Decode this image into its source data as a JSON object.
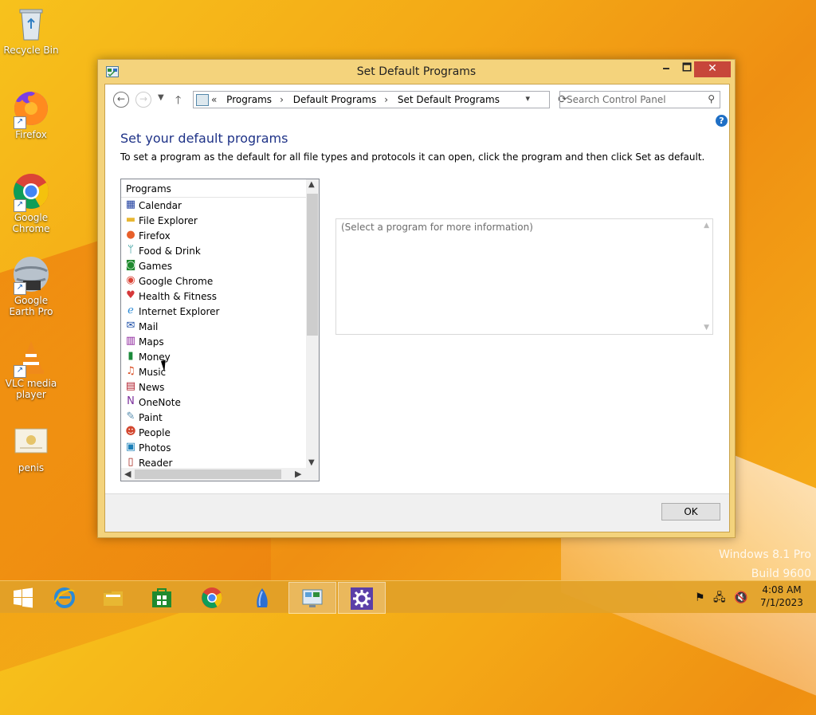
{
  "desktop": {
    "icons": [
      {
        "label": "Recycle Bin"
      },
      {
        "label": "Firefox"
      },
      {
        "label": "Google Chrome"
      },
      {
        "label": "Google Earth Pro"
      },
      {
        "label": "VLC media player"
      },
      {
        "label": "penis"
      }
    ],
    "watermark": {
      "line1": "Windows 8.1 Pro",
      "line2": "Build 9600"
    }
  },
  "window": {
    "title": "Set Default Programs",
    "controls": {
      "minimize": "🗕",
      "maximize": "🗖",
      "close": "✕"
    },
    "breadcrumb": {
      "prefix": "«",
      "items": [
        "Programs",
        "Default Programs",
        "Set Default Programs"
      ],
      "separator": "›"
    },
    "search_placeholder": "Search Control Panel",
    "heading": "Set your default programs",
    "description": "To set a program as the default for all file types and protocols it can open, click the program and then click Set as default.",
    "list": {
      "header": "Programs",
      "items": [
        {
          "label": "Calendar",
          "icon": "calendar-icon",
          "color": "#1f3fa0"
        },
        {
          "label": "File Explorer",
          "icon": "folder-icon",
          "color": "#e8b732"
        },
        {
          "label": "Firefox",
          "icon": "firefox-icon",
          "color": "#e8602b"
        },
        {
          "label": "Food & Drink",
          "icon": "food-drink-icon",
          "color": "#0e8a8a"
        },
        {
          "label": "Games",
          "icon": "games-icon",
          "color": "#1f8a2f"
        },
        {
          "label": "Google Chrome",
          "icon": "chrome-icon",
          "color": "#db4437"
        },
        {
          "label": "Health & Fitness",
          "icon": "health-icon",
          "color": "#d6383a"
        },
        {
          "label": "Internet Explorer",
          "icon": "ie-icon",
          "color": "#2a8ad6"
        },
        {
          "label": "Mail",
          "icon": "mail-icon",
          "color": "#1d4fa8"
        },
        {
          "label": "Maps",
          "icon": "maps-icon",
          "color": "#8b1f9a"
        },
        {
          "label": "Money",
          "icon": "money-icon",
          "color": "#1b8a3a"
        },
        {
          "label": "Music",
          "icon": "music-icon",
          "color": "#d94a1f"
        },
        {
          "label": "News",
          "icon": "news-icon",
          "color": "#b01e2c"
        },
        {
          "label": "OneNote",
          "icon": "onenote-icon",
          "color": "#7b2f9c"
        },
        {
          "label": "Paint",
          "icon": "paint-icon",
          "color": "#5a8fb0"
        },
        {
          "label": "People",
          "icon": "people-icon",
          "color": "#d2462e"
        },
        {
          "label": "Photos",
          "icon": "photos-icon",
          "color": "#1a7fb8"
        },
        {
          "label": "Reader",
          "icon": "reader-icon",
          "color": "#a5261e"
        }
      ]
    },
    "info_placeholder": "(Select a program for more information)",
    "ok_label": "OK",
    "help_label": "?"
  },
  "taskbar": {
    "apps": [
      {
        "name": "internet-explorer",
        "color": "#2a8ad6"
      },
      {
        "name": "file-explorer",
        "color": "#e8b732"
      },
      {
        "name": "store",
        "color": "#1f8a2f"
      },
      {
        "name": "chrome",
        "color": "#db4437"
      },
      {
        "name": "google-earth",
        "color": "#2d6fd1"
      },
      {
        "name": "control-panel",
        "color": "#5aa0d8"
      },
      {
        "name": "settings",
        "color": "#5b3fa8"
      }
    ],
    "time": "4:08 AM",
    "date": "7/1/2023"
  },
  "colors": {
    "accent_heading": "#1e3287",
    "window_frame": "#f4d37c",
    "close_red": "#c7463a"
  }
}
